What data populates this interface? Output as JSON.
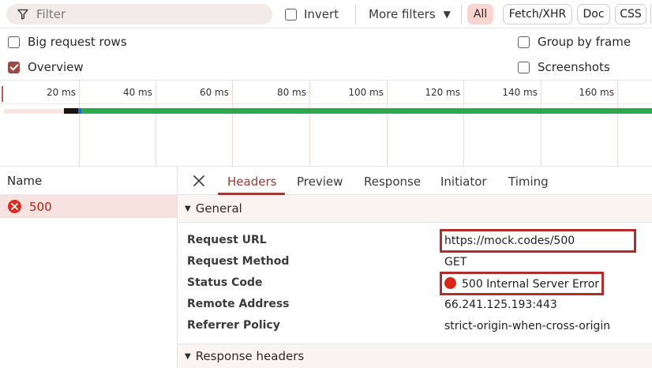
{
  "filter": {
    "placeholder": "Filter",
    "invert_label": "Invert",
    "more_filters_label": "More filters",
    "chips": [
      "All",
      "Fetch/XHR",
      "Doc",
      "CSS"
    ]
  },
  "options": {
    "big_request_rows": "Big request rows",
    "overview": "Overview",
    "group_by_frame": "Group by frame",
    "screenshots": "Screenshots"
  },
  "timeline": {
    "ticks": [
      "20 ms",
      "40 ms",
      "60 ms",
      "80 ms",
      "100 ms",
      "120 ms",
      "140 ms",
      "160 ms"
    ]
  },
  "request_list": {
    "header": "Name",
    "rows": [
      {
        "name": "500",
        "status": "error"
      }
    ]
  },
  "detail": {
    "tabs": [
      "Headers",
      "Preview",
      "Response",
      "Initiator",
      "Timing"
    ],
    "active_tab": "Headers",
    "general_label": "General",
    "fields": [
      {
        "key": "Request URL",
        "value": "https://mock.codes/500"
      },
      {
        "key": "Request Method",
        "value": "GET"
      },
      {
        "key": "Status Code",
        "value": "500 Internal Server Error"
      },
      {
        "key": "Remote Address",
        "value": "66.241.125.193:443"
      },
      {
        "key": "Referrer Policy",
        "value": "strict-origin-when-cross-origin"
      }
    ],
    "response_headers_label": "Response headers"
  },
  "colors": {
    "accent": "#9b3a33",
    "error": "#d9261d",
    "highlight_box": "#b22d2a"
  }
}
